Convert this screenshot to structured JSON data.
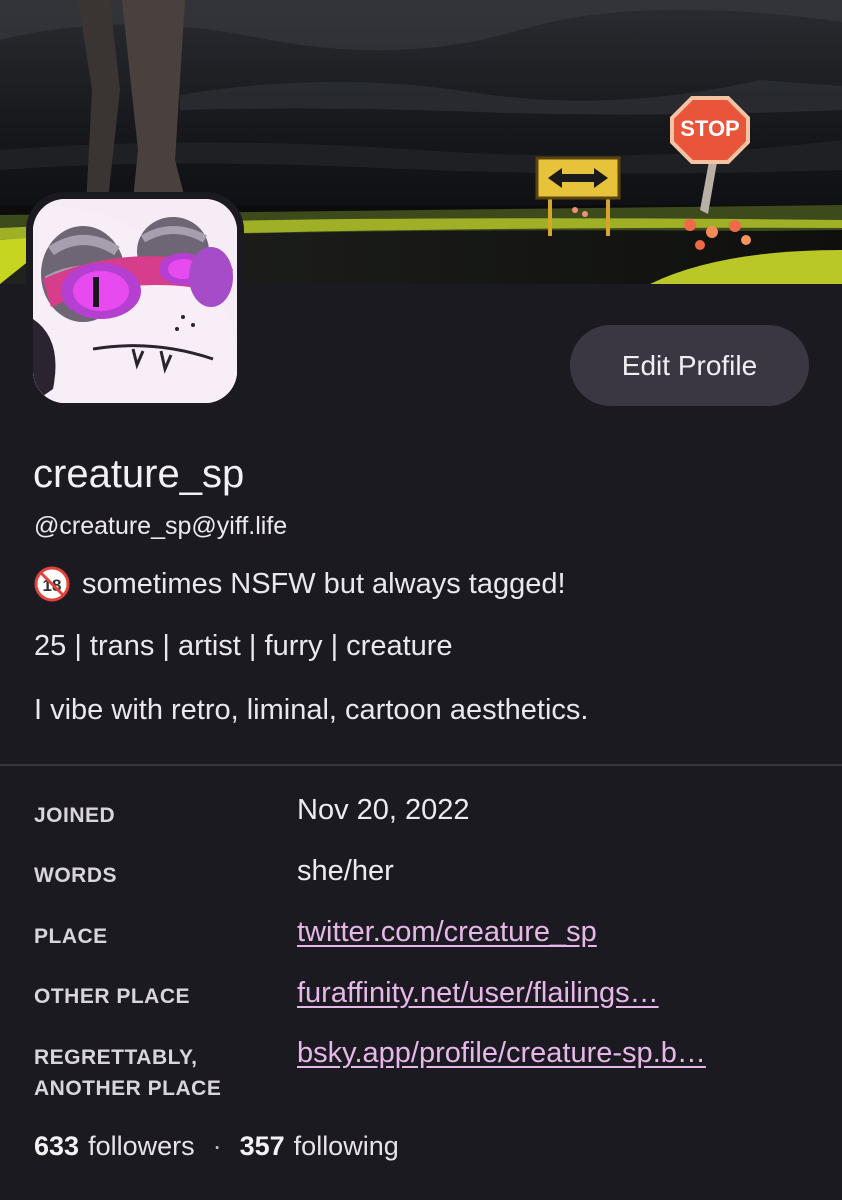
{
  "profile": {
    "display_name": "creature_sp",
    "handle": "@creature_sp@yiff.life",
    "edit_button_label": "Edit Profile",
    "banner_sign_text": "STOP",
    "bio": {
      "line1_icon": "no-under-18-icon",
      "line1_icon_text": "18",
      "line1": "sometimes NSFW but always tagged!",
      "line2": "25 | trans | artist | furry | creature",
      "line3": "I vibe with retro, liminal, cartoon aesthetics."
    },
    "fields": [
      {
        "label": "JOINED",
        "value": "Nov 20, 2022"
      },
      {
        "label": "WORDS",
        "value": "she/her"
      },
      {
        "label": "PLACE",
        "value": "twitter.com/creature_sp"
      },
      {
        "label": "OTHER PLACE",
        "value": "furaffinity.net/user/flailings…"
      },
      {
        "label": "REGRETTABLY,\nANOTHER PLACE",
        "value": "bsky.app/profile/creature-sp.b…"
      }
    ],
    "stats": {
      "followers_count": "633",
      "followers_label": "followers",
      "separator": "·",
      "following_count": "357",
      "following_label": "following"
    }
  },
  "colors": {
    "background": "#1c1a21",
    "button_bg": "#3b3742",
    "link": "#e7b7ea",
    "divider": "#38353d"
  }
}
